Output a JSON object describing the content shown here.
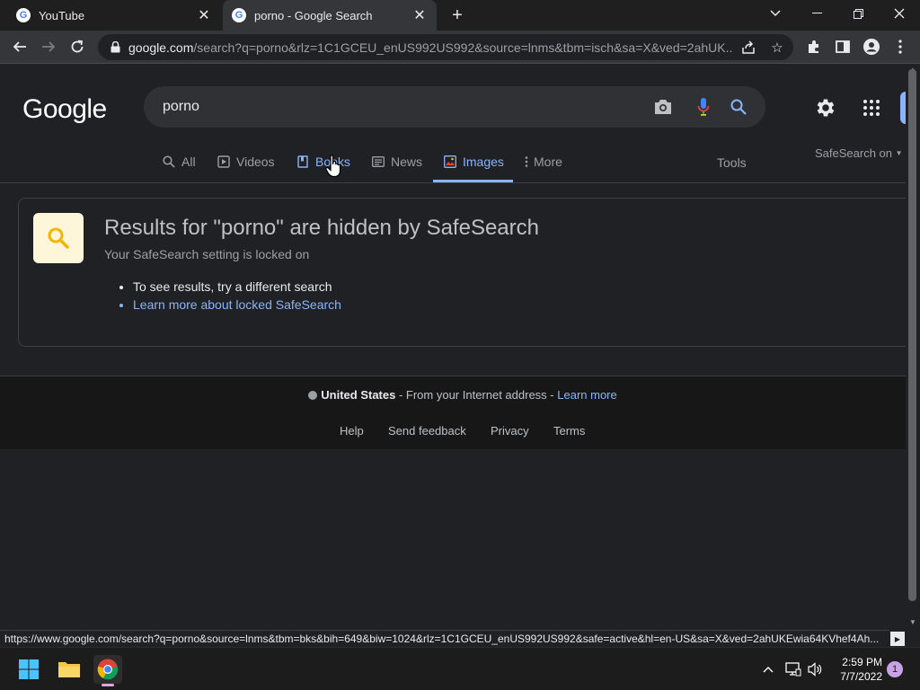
{
  "browser": {
    "tabs": [
      {
        "title": "YouTube",
        "active": false
      },
      {
        "title": "porno - Google Search",
        "active": true
      }
    ],
    "url_host": "google.com",
    "url_path": "/search?q=porno&rlz=1C1GCEU_enUS992US992&source=lnms&tbm=isch&sa=X&ved=2ahUK...",
    "status_url": "https://www.google.com/search?q=porno&source=lnms&tbm=bks&bih=649&biw=1024&rlz=1C1GCEU_enUS992US992&safe=active&hl=en-US&sa=X&ved=2ahUKEwia64KVhef4Ah..."
  },
  "google": {
    "logo": "Google",
    "query": "porno",
    "nav_tabs": [
      {
        "label": "All",
        "icon": "search-icon"
      },
      {
        "label": "Videos",
        "icon": "play-icon"
      },
      {
        "label": "Books",
        "icon": "book-icon"
      },
      {
        "label": "News",
        "icon": "news-icon"
      },
      {
        "label": "Images",
        "icon": "image-icon",
        "active": true
      },
      {
        "label": "More",
        "icon": "more-vertical-icon"
      }
    ],
    "tools_label": "Tools",
    "safesearch_label": "SafeSearch on"
  },
  "notice": {
    "title": "Results for \"porno\" are hidden by SafeSearch",
    "subtitle": "Your SafeSearch setting is locked on",
    "bullets": [
      "To see results, try a different search"
    ],
    "link": "Learn more about locked SafeSearch"
  },
  "footer": {
    "country": "United States",
    "location_text": " - From your Internet address - ",
    "learn_more": "Learn more",
    "links": [
      "Help",
      "Send feedback",
      "Privacy",
      "Terms"
    ]
  },
  "taskbar": {
    "time": "2:59 PM",
    "date": "7/7/2022",
    "notifications": "1"
  },
  "colors": {
    "accent": "#8ab4f8",
    "page_bg": "#202124",
    "badge_bg": "#fdf6d8",
    "badge_icon": "#f4b400"
  }
}
